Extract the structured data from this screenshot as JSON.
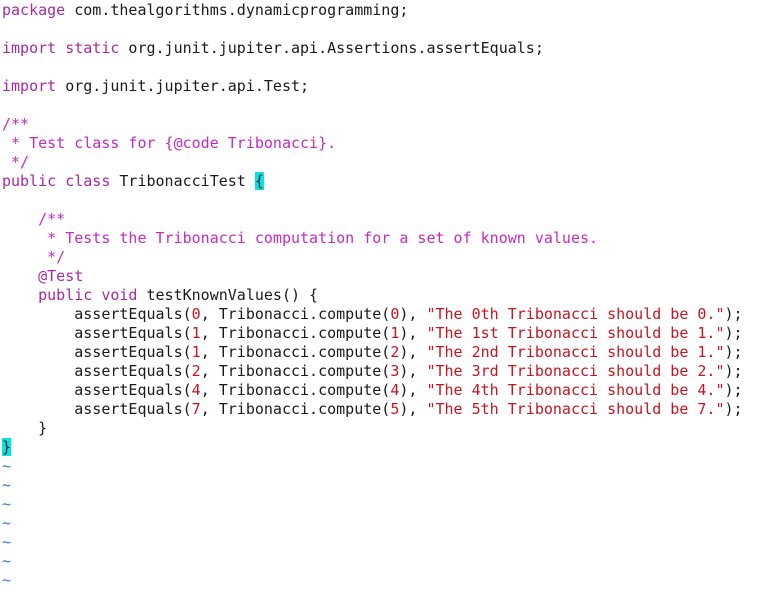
{
  "editor": {
    "lines": {
      "l1": {
        "kw": "package",
        "rest": " com.thealgorithms.dynamicprogramming;"
      },
      "l3": {
        "kw": "import static",
        "rest": " org.junit.jupiter.api.Assertions.assertEquals;"
      },
      "l5": {
        "kw": "import",
        "rest": " org.junit.jupiter.api.Test;"
      },
      "l7": "/**",
      "l8": " * Test class for {@code Tribonacci}.",
      "l9": " */",
      "l10": {
        "kw": "public class",
        "name": " TribonacciTest ",
        "brace": "{"
      },
      "l12": "    /**",
      "l13": "     * Tests the Tribonacci computation for a set of known values.",
      "l14": "     */",
      "l15": {
        "indent": "    ",
        "annotation": "@Test"
      },
      "l16": {
        "indent": "    ",
        "kw": "public void",
        "rest": " testKnownValues() {"
      },
      "asserts": [
        {
          "pre": "        assertEquals(",
          "n1": "0",
          "mid": ", Tribonacci.compute(",
          "n2": "0",
          "post": "), ",
          "str": "\"The 0th Tribonacci should be 0.\"",
          "end": ");"
        },
        {
          "pre": "        assertEquals(",
          "n1": "1",
          "mid": ", Tribonacci.compute(",
          "n2": "1",
          "post": "), ",
          "str": "\"The 1st Tribonacci should be 1.\"",
          "end": ");"
        },
        {
          "pre": "        assertEquals(",
          "n1": "1",
          "mid": ", Tribonacci.compute(",
          "n2": "2",
          "post": "), ",
          "str": "\"The 2nd Tribonacci should be 1.\"",
          "end": ");"
        },
        {
          "pre": "        assertEquals(",
          "n1": "2",
          "mid": ", Tribonacci.compute(",
          "n2": "3",
          "post": "), ",
          "str": "\"The 3rd Tribonacci should be 2.\"",
          "end": ");"
        },
        {
          "pre": "        assertEquals(",
          "n1": "4",
          "mid": ", Tribonacci.compute(",
          "n2": "4",
          "post": "), ",
          "str": "\"The 4th Tribonacci should be 4.\"",
          "end": ");"
        },
        {
          "pre": "        assertEquals(",
          "n1": "7",
          "mid": ", Tribonacci.compute(",
          "n2": "5",
          "post": "), ",
          "str": "\"The 5th Tribonacci should be 7.\"",
          "end": ");"
        }
      ],
      "l23": "    }",
      "l24": "}"
    },
    "tilde": "~"
  },
  "colors": {
    "keyword": "#a52aa5",
    "comment": "#c42ac4",
    "string": "#c8141e",
    "cursor": "#00e5e5",
    "tilde": "#2a7fd4"
  }
}
